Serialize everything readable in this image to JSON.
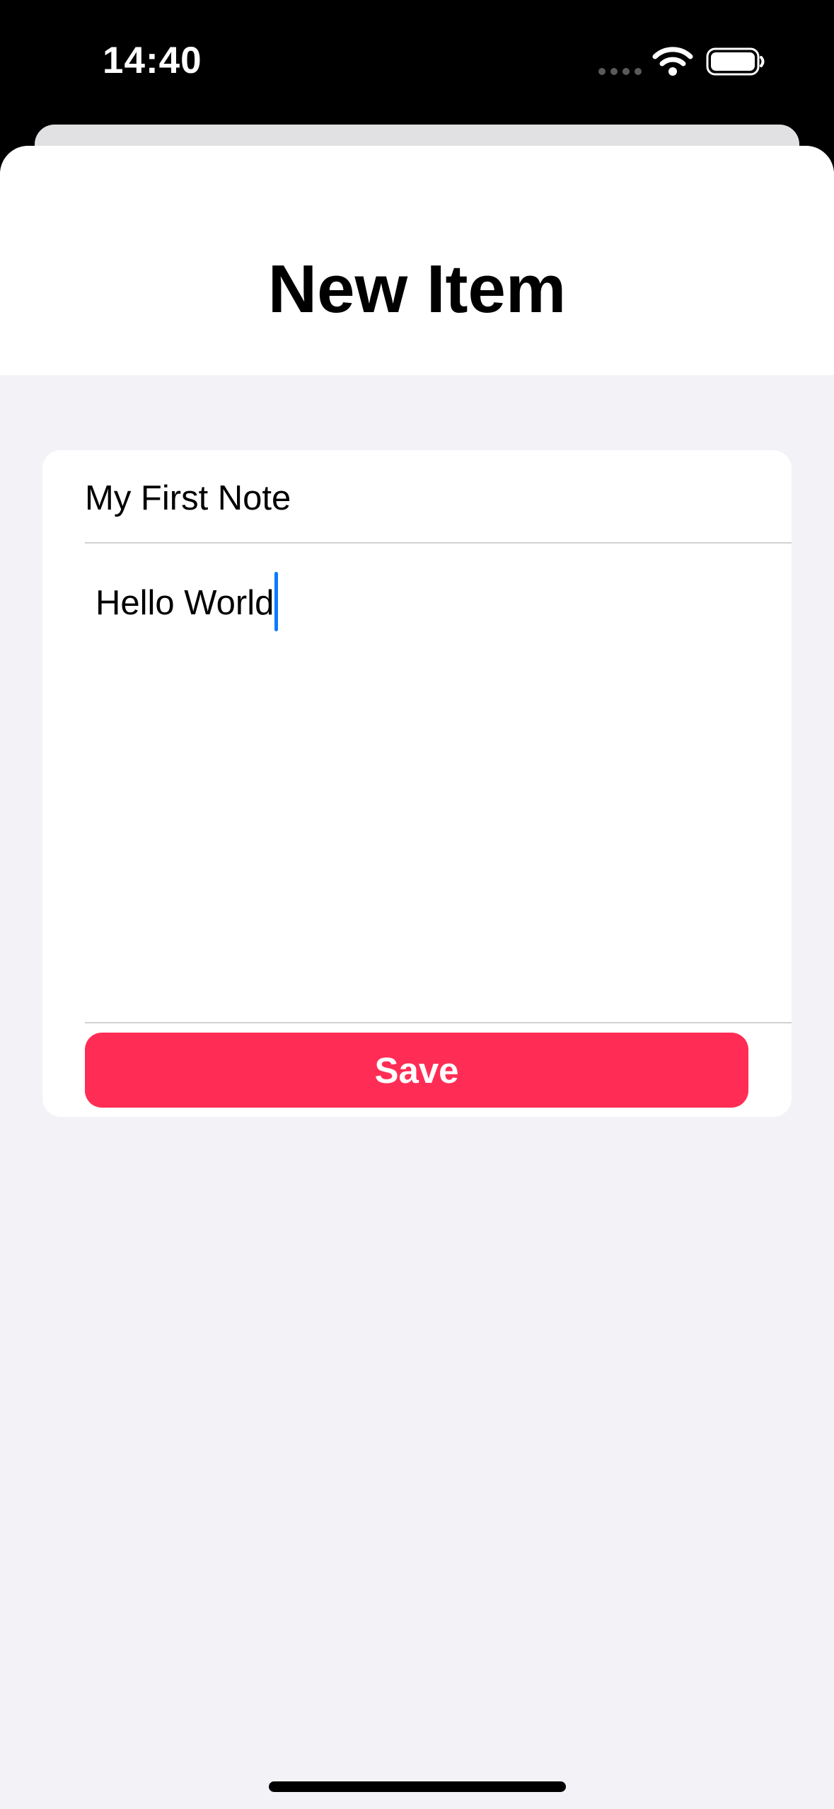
{
  "status_bar": {
    "time": "14:40",
    "icons": [
      "signal-dots-icon",
      "wifi-icon",
      "battery-icon"
    ]
  },
  "header": {
    "title": "New Item"
  },
  "form": {
    "title_value": "My First Note",
    "body_value": "Hello World",
    "save_label": "Save"
  },
  "colors": {
    "accent": "#ff2d55",
    "caret": "#0a7aff",
    "background": "#f2f2f7"
  }
}
